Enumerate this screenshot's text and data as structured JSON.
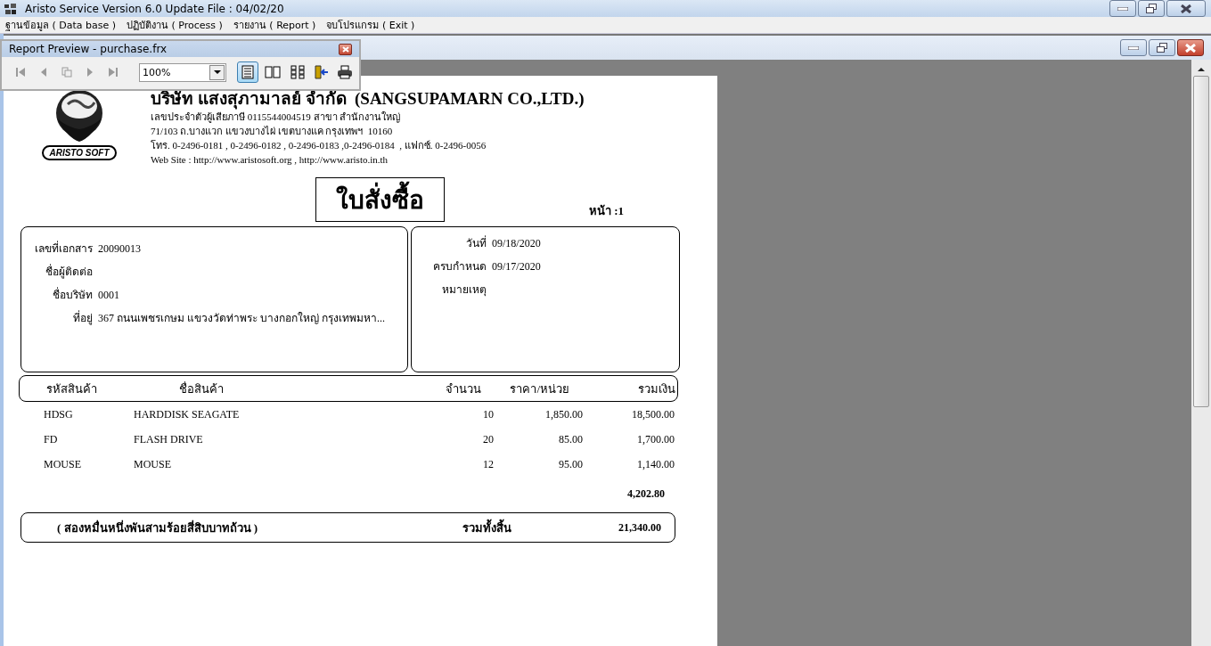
{
  "window": {
    "title": "Aristo Service Version 6.0 Update File : 04/02/20"
  },
  "menu": [
    "ฐานข้อมูล ( Data base )",
    "ปฏิบัติงาน ( Process )",
    "รายงาน ( Report )",
    "จบโปรแกรม ( Exit )"
  ],
  "report_preview": {
    "title": "Report Preview - purchase.frx",
    "zoom": "100%",
    "buttons": [
      {
        "kind": "first",
        "disabled": true
      },
      {
        "kind": "prev",
        "disabled": true
      },
      {
        "kind": "copy",
        "disabled": true
      },
      {
        "kind": "next",
        "disabled": true
      },
      {
        "kind": "last",
        "disabled": true
      }
    ],
    "views": [
      {
        "kind": "one",
        "selected": true
      },
      {
        "kind": "two",
        "selected": false
      },
      {
        "kind": "grid",
        "selected": false
      }
    ]
  },
  "report": {
    "logo_text": "ARISTO SOFT",
    "company": "บริษัท แสงสุภามาลย์ จำกัด  (SANGSUPAMARN CO.,LTD.)",
    "company_lines": [
      "เลขประจำตัวผู้เสียภาษี 0115544004519 สาขา สำนักงานใหญ่",
      "71/103 ถ.บางแวก แขวงบางไผ่ เขตบางแค กรุงเทพฯ  10160",
      "โทร. 0-2496-0181 , 0-2496-0182 , 0-2496-0183 ,0-2496-0184  , แฟกซ์. 0-2496-0056",
      "Web Site : http://www.aristosoft.org , http://www.aristo.in.th"
    ],
    "title": "ใบสั่งซื้อ",
    "page": "หน้า :1",
    "left_fields": [
      {
        "label": "เลขที่เอกสาร",
        "value": "20090013"
      },
      {
        "label": "ชื่อผู้ติดต่อ"
      },
      {
        "label": "ชื่อบริษัท",
        "value": "0001"
      },
      {
        "label": "ที่อยู่",
        "value": "367 ถนนเพชรเกษม แขวงวัดท่าพระ บางกอกใหญ่ กรุงเทพมหา..."
      }
    ],
    "right_fields": [
      {
        "label": "วันที่",
        "value": "09/18/2020"
      },
      {
        "label": "ครบกำหนด",
        "value": "09/17/2020"
      },
      {
        "label": "หมายเหตุ"
      }
    ],
    "columns": [
      "รหัสสินค้า",
      "ชื่อสินค้า",
      "จำนวน",
      "ราคา/หน่วย",
      "รวมเงิน"
    ],
    "rows": [
      [
        "HDSG",
        "HARDDISK SEAGATE",
        "10",
        "1,850.00",
        "18,500.00"
      ],
      [
        "FD",
        "FLASH DRIVE",
        "20",
        "85.00",
        "1,700.00"
      ],
      [
        "MOUSE",
        "MOUSE",
        "12",
        "95.00",
        "1,140.00"
      ]
    ],
    "subtotal": "4,202.80",
    "amount_words": "( สองหมื่นหนึ่งพันสามร้อยสี่สิบบาทถ้วน )",
    "total_label": "รวมทั้งสิ้น",
    "total": "21,340.00"
  }
}
